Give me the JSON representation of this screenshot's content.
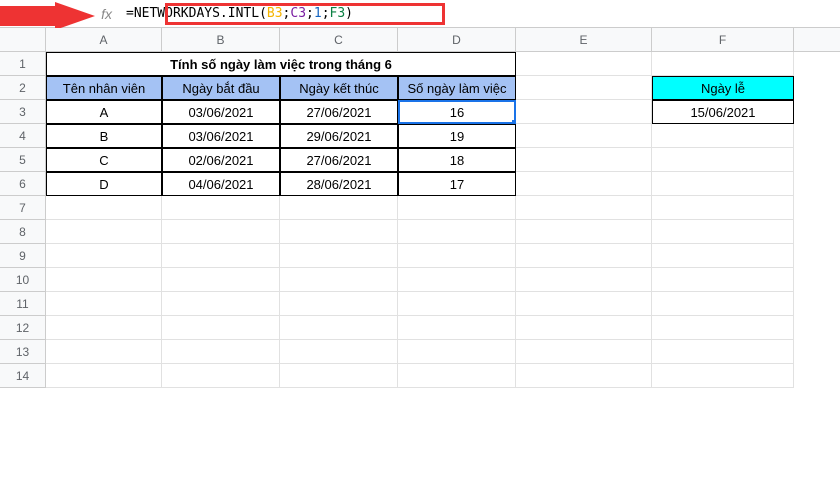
{
  "formula_bar": {
    "fx_label": "fx",
    "formula_parts": {
      "eq": "=",
      "fn": "NETWORKDAYS.INTL",
      "open": "(",
      "arg1": "B3",
      "sep1": ";",
      "arg2": "C3",
      "sep2": ";",
      "arg3": "1",
      "sep3": ";",
      "arg4": "F3",
      "close": ")"
    }
  },
  "columns": {
    "A": "A",
    "B": "B",
    "C": "C",
    "D": "D",
    "E": "E",
    "F": "F"
  },
  "rows": {
    "1": "1",
    "2": "2",
    "3": "3",
    "4": "4",
    "5": "5",
    "6": "6",
    "7": "7",
    "8": "8",
    "9": "9",
    "10": "10",
    "11": "11",
    "12": "12",
    "13": "13",
    "14": "14"
  },
  "main_table": {
    "title": "Tính số ngày làm việc trong tháng 6",
    "headers": {
      "col_a": "Tên nhân viên",
      "col_b": "Ngày bắt đầu",
      "col_c": "Ngày kết thúc",
      "col_d": "Số ngày làm việc"
    },
    "rows": [
      {
        "name": "A",
        "start": "03/06/2021",
        "end": "27/06/2021",
        "days": "16"
      },
      {
        "name": "B",
        "start": "03/06/2021",
        "end": "29/06/2021",
        "days": "19"
      },
      {
        "name": "C",
        "start": "02/06/2021",
        "end": "27/06/2021",
        "days": "18"
      },
      {
        "name": "D",
        "start": "04/06/2021",
        "end": "28/06/2021",
        "days": "17"
      }
    ]
  },
  "holiday_table": {
    "header": "Ngày lễ",
    "value": "15/06/2021"
  },
  "selected_cell": "D3"
}
